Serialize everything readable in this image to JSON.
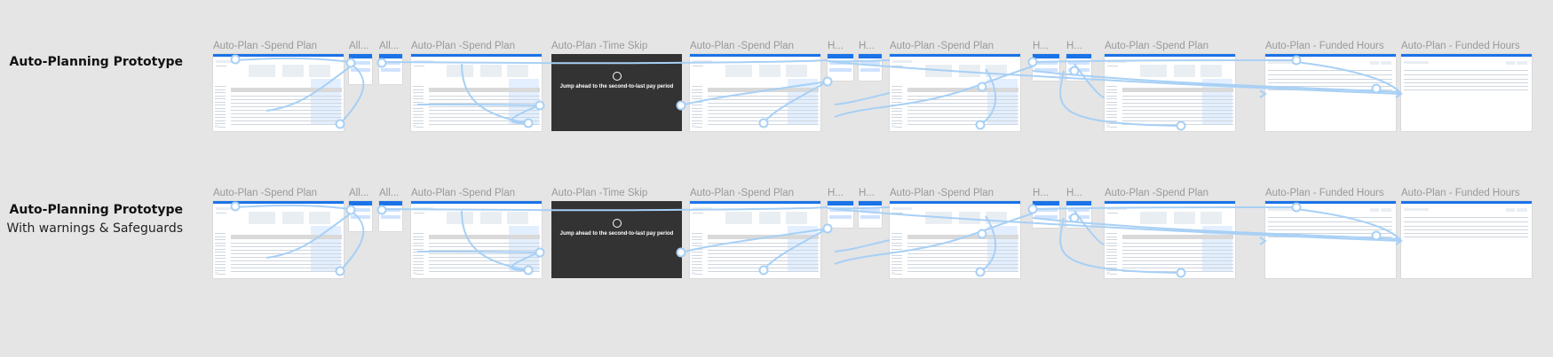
{
  "rows": [
    {
      "title": "Auto-Planning Prototype",
      "subtitle": "",
      "labels": {
        "spend1": "Auto-Plan -Spend Plan",
        "all1": "All...",
        "all2": "All...",
        "spend2": "Auto-Plan -Spend Plan",
        "time": "Auto-Plan -Time Skip",
        "spend3": "Auto-Plan -Spend Plan",
        "h1": "H...",
        "h2": "H...",
        "spend4": "Auto-Plan -Spend Plan",
        "h3": "H...",
        "h4": "H...",
        "spend5": "Auto-Plan -Spend Plan",
        "funded1": "Auto-Plan - Funded Hours",
        "funded2": "Auto-Plan - Funded Hours"
      },
      "time_skip_message": "Jump ahead to the second-to-last pay period"
    },
    {
      "title": "Auto-Planning Prototype",
      "subtitle": "With warnings & Safeguards",
      "labels": {
        "spend1": "Auto-Plan -Spend Plan",
        "all1": "All...",
        "all2": "All...",
        "spend2": "Auto-Plan -Spend Plan",
        "time": "Auto-Plan -Time Skip",
        "spend3": "Auto-Plan -Spend Plan",
        "h1": "H...",
        "h2": "H...",
        "spend4": "Auto-Plan -Spend Plan",
        "h3": "H...",
        "h4": "H...",
        "spend5": "Auto-Plan -Spend Plan",
        "funded1": "Auto-Plan - Funded Hours",
        "funded2": "Auto-Plan - Funded Hours"
      },
      "time_skip_message": "Jump ahead to the second-to-last pay period"
    }
  ],
  "colors": {
    "canvas": "#e5e5e5",
    "connector": "#a8d0f5",
    "accent": "#1a73e8",
    "time_skip_bg": "#333333",
    "frame_label": "#999999"
  }
}
